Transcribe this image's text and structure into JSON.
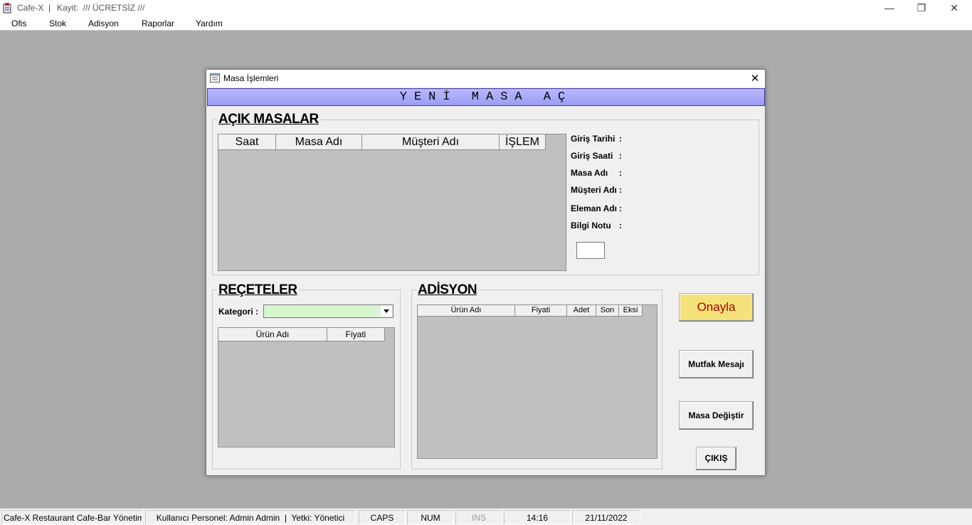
{
  "app": {
    "title": "Cafe-X",
    "separator": "|",
    "license": "Kayit:  /// ÜCRETSİZ ///",
    "menu": [
      "Ofis",
      "Stok",
      "Adisyon",
      "Raporlar",
      "Yardım"
    ],
    "controls": {
      "minimize": "—",
      "restore": "❐",
      "close": "✕"
    }
  },
  "dialog": {
    "title": "Masa İşlemleri",
    "close": "✕",
    "banner": "YENİ MASA AÇ",
    "open_tables": {
      "title": "AÇIK MASALAR",
      "columns": [
        "Saat",
        "Masa Adı",
        "Müşteri Adı",
        "İŞLEM"
      ],
      "info": [
        {
          "label": "Giriş Tarihi",
          "colon": ":"
        },
        {
          "label": "Giriş Saati",
          "colon": ":"
        },
        {
          "label": "Masa Adı",
          "colon": ":"
        },
        {
          "label": "Müşteri Adı",
          "colon": ":"
        },
        {
          "label": "Eleman Adı",
          "colon": ":"
        },
        {
          "label": "Bilgi Notu",
          "colon": ":"
        }
      ]
    },
    "recipes": {
      "title": "REÇETELER",
      "category_label": "Kategori :",
      "category_value": "",
      "columns": [
        "Ürün Adı",
        "Fiyati"
      ]
    },
    "ticket": {
      "title": "ADİSYON",
      "columns": [
        "Ürün Adı",
        "Fiyati",
        "Adet",
        "Son",
        "Eksi"
      ]
    },
    "buttons": {
      "confirm": "Onayla",
      "kitchen": "Mutfak Mesajı",
      "change_table": "Masa Değiştir",
      "exit": "ÇIKIŞ"
    }
  },
  "status": {
    "app_name": "Cafe-X Restaurant Cafe-Bar Yönetim",
    "user": "Kullanıcı Personel: Admin Admin  |  Yetki: Yönetici",
    "caps": "CAPS",
    "num": "NUM",
    "ins": "INS",
    "time": "14:16",
    "date": "21/11/2022"
  },
  "colors": {
    "banner": "#9c9cf4",
    "confirm_bg": "#f5e27a",
    "confirm_text": "#b00000",
    "combo_bg": "#d6f5d0",
    "grid_bg": "#c0c0c0",
    "desktop": "#ababab"
  }
}
